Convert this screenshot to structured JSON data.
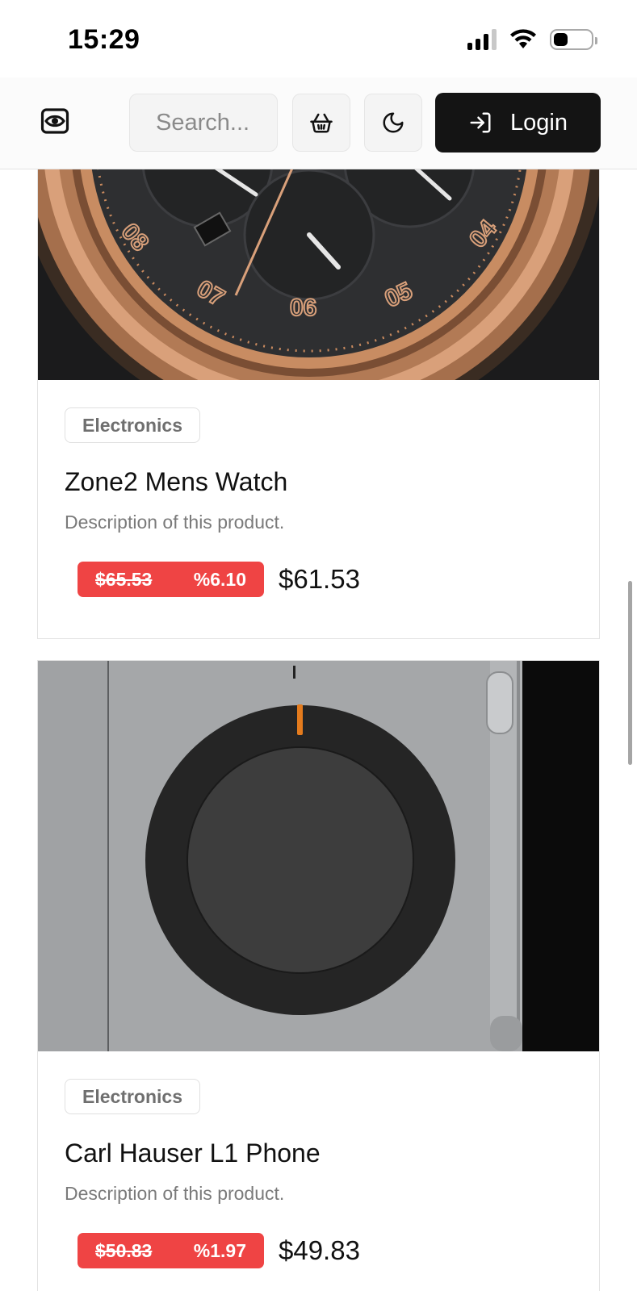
{
  "status_bar": {
    "time": "15:29"
  },
  "header": {
    "logo_icon": "eye-in-frame-icon",
    "search_placeholder": "Search...",
    "cart_icon": "basket-icon",
    "theme_icon": "moon-icon",
    "login_icon": "login-arrow-icon",
    "login_label": "Login"
  },
  "products": [
    {
      "category": "Electronics",
      "name": "Zone2 Mens Watch",
      "description": "Description of this product.",
      "old_price": "$65.53",
      "discount": "%6.10",
      "price": "$61.53"
    },
    {
      "category": "Electronics",
      "name": "Carl Hauser L1 Phone",
      "description": "Description of this product.",
      "old_price": "$50.83",
      "discount": "%1.97",
      "price": "$49.83"
    }
  ],
  "colors": {
    "discount": "#ef4444",
    "login_bg": "#141414",
    "watch_bronze": "#c98a5e",
    "watch_dial": "#2e2f31",
    "device_body": "#a5a7a9"
  }
}
